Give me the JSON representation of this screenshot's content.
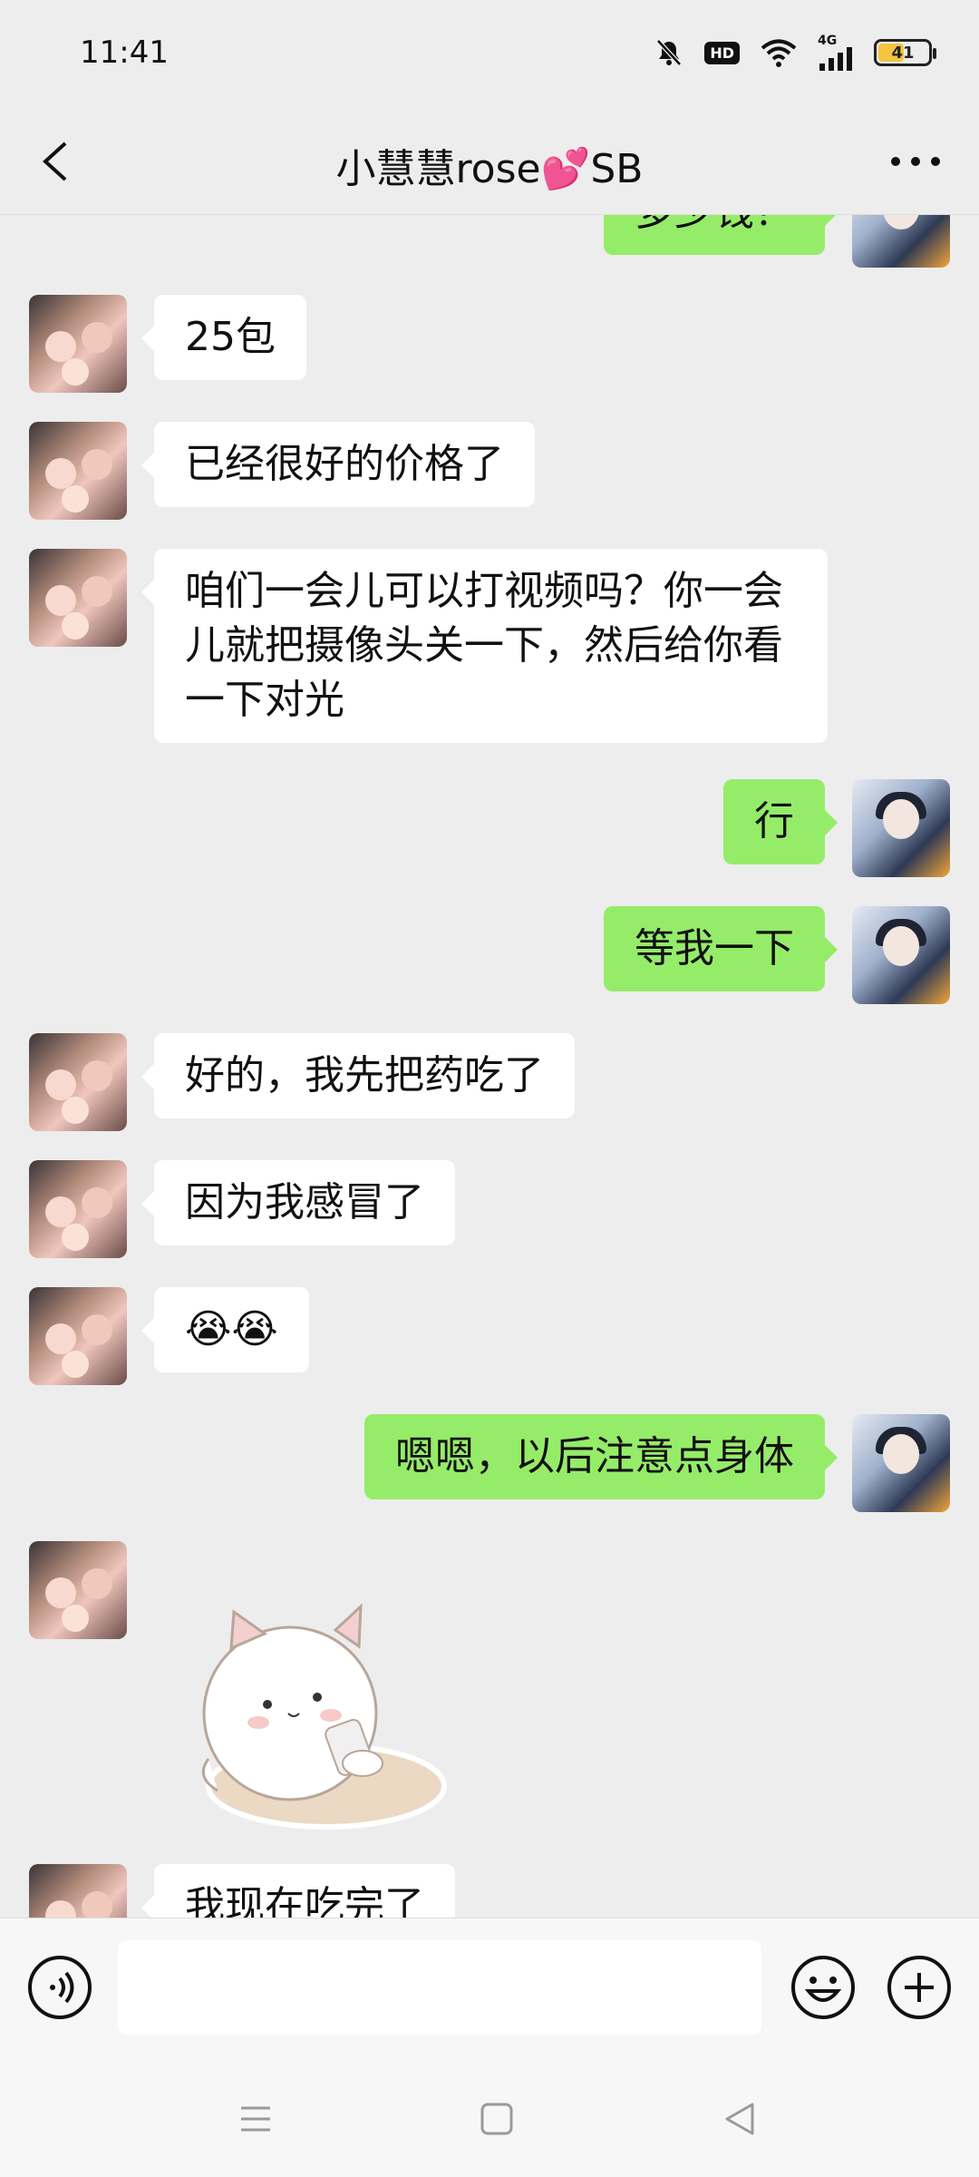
{
  "status_bar": {
    "time": "11:41",
    "hd": "HD",
    "network": "4G",
    "battery": "41"
  },
  "header": {
    "title": "小慧慧rose💕SB"
  },
  "messages": [
    {
      "side": "out",
      "text": "多少钱？"
    },
    {
      "side": "in",
      "text": "25包"
    },
    {
      "side": "in",
      "text": "已经很好的价格了"
    },
    {
      "side": "in",
      "text": "咱们一会儿可以打视频吗？你一会儿就把摄像头关一下，然后给你看一下对光"
    },
    {
      "side": "out",
      "text": "行"
    },
    {
      "side": "out",
      "text": "等我一下"
    },
    {
      "side": "in",
      "text": "好的，我先把药吃了"
    },
    {
      "side": "in",
      "text": "因为我感冒了"
    },
    {
      "side": "in",
      "text": "😭😭"
    },
    {
      "side": "out",
      "text": "嗯嗯，以后注意点身体"
    },
    {
      "side": "in",
      "sticker": "cat-sticker"
    },
    {
      "side": "in",
      "text": "我现在吃完了"
    }
  ],
  "input_bar": {
    "value": "",
    "icons": [
      "voice-icon",
      "emoji-icon",
      "plus-icon"
    ]
  },
  "nav_bar": {
    "icons": [
      "menu-icon",
      "home-icon",
      "back-icon"
    ]
  },
  "colors": {
    "background": "#ededed",
    "outgoing_bubble": "#95ec69",
    "incoming_bubble": "#ffffff"
  }
}
